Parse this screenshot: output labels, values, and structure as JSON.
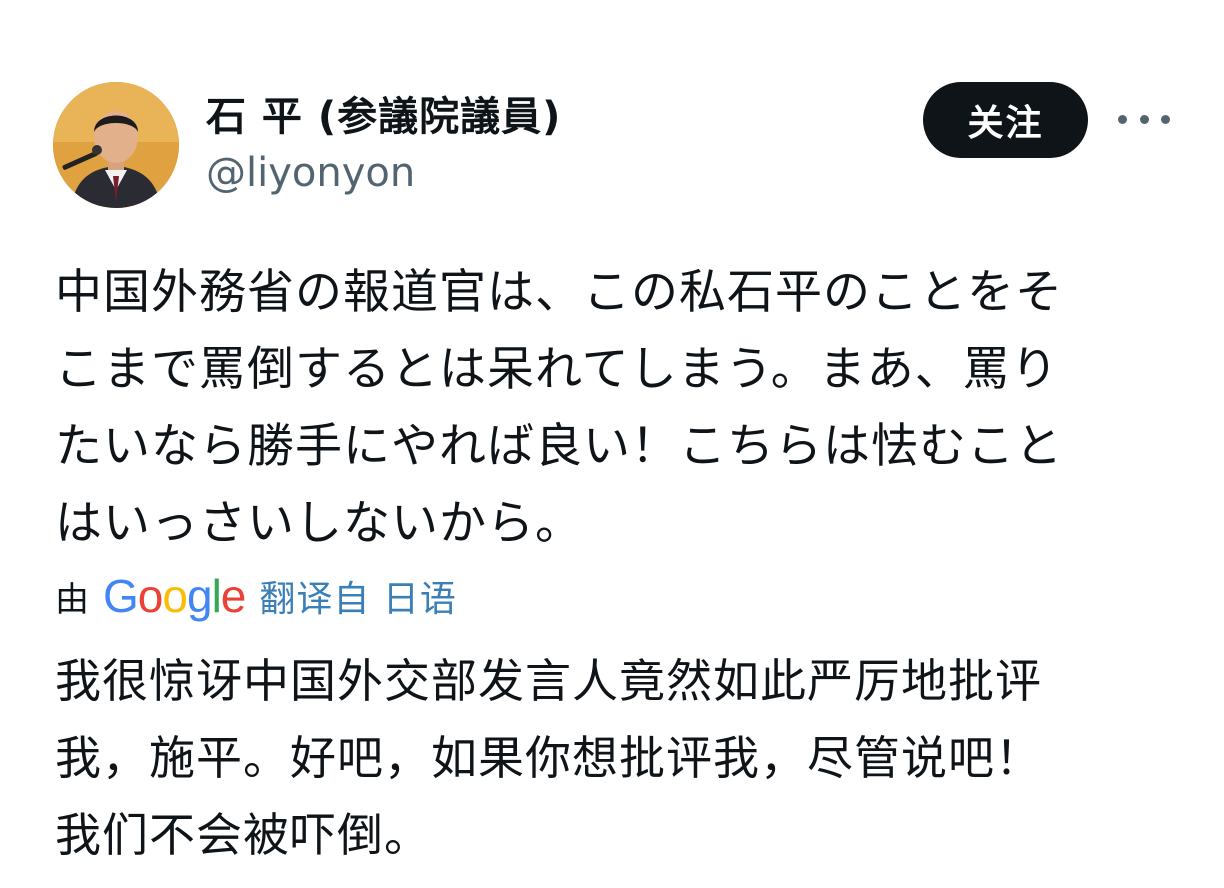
{
  "author": {
    "display_name": "石 平 (参議院議員)",
    "handle": "@liyonyon"
  },
  "actions": {
    "follow_label": "关注"
  },
  "tweet": {
    "lines": [
      "中国外務省の報道官は、この私石平のことをそ",
      "こまで罵倒するとは呆れてしまう。まあ、罵り",
      "たいなら勝手にやれば良い！こちらは怯むこと",
      "はいっさいしないから。"
    ]
  },
  "translation": {
    "prefix": "由",
    "provider_letters": [
      "G",
      "o",
      "o",
      "g",
      "l",
      "e"
    ],
    "link_label": "翻译自 日语",
    "lines": [
      "我很惊讶中国外交部发言人竟然如此严厉地批评",
      "我，施平。好吧，如果你想批评我，尽管说吧！",
      "我们不会被吓倒。"
    ]
  },
  "colors": {
    "follow_bg": "#0f1419",
    "handle": "#536471",
    "link": "#3b7fb8"
  }
}
